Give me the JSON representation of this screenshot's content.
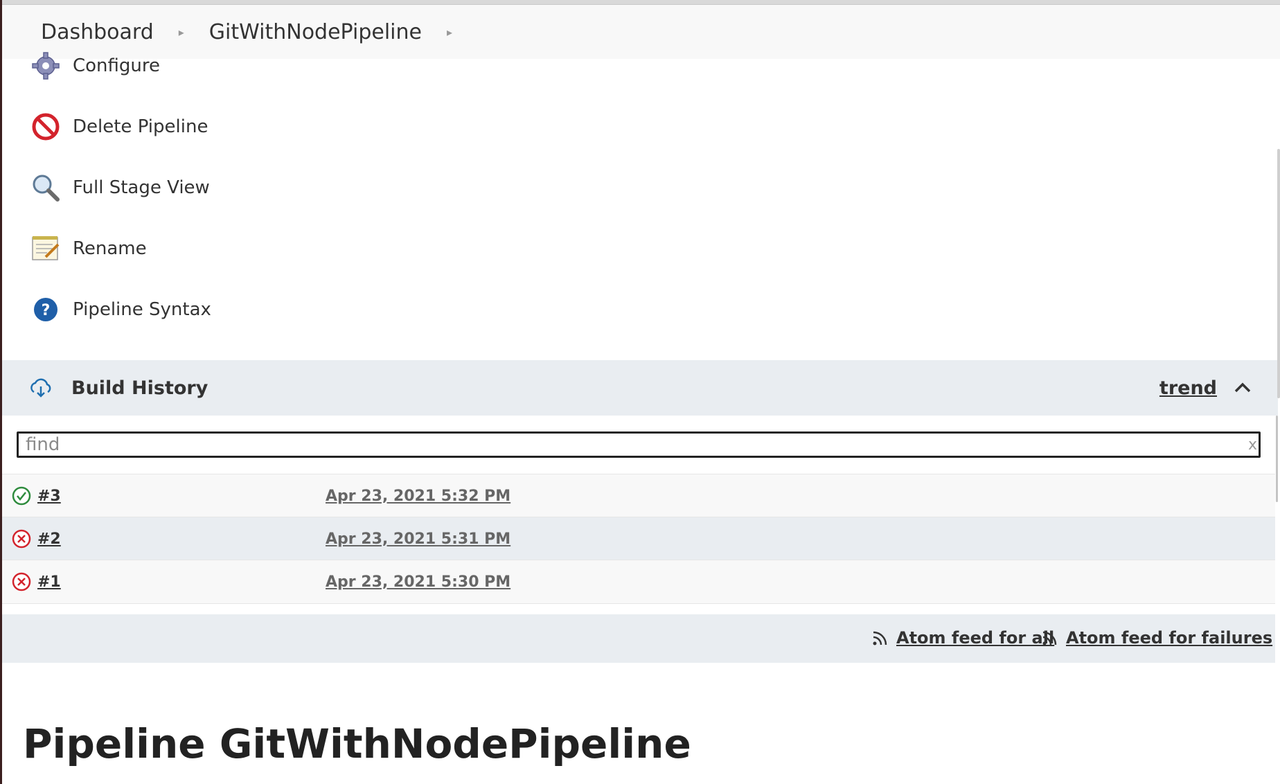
{
  "breadcrumb": {
    "items": [
      "Dashboard",
      "GitWithNodePipeline"
    ]
  },
  "tasks": [
    {
      "label": "Configure",
      "icon": "gear-icon"
    },
    {
      "label": "Delete Pipeline",
      "icon": "no-entry-icon"
    },
    {
      "label": "Full Stage View",
      "icon": "magnifier-icon"
    },
    {
      "label": "Rename",
      "icon": "notepad-pencil-icon"
    },
    {
      "label": "Pipeline Syntax",
      "icon": "help-icon"
    }
  ],
  "build_history": {
    "title": "Build History",
    "trend_label": "trend",
    "find_placeholder": "find",
    "find_clear": "x",
    "builds": [
      {
        "number": "#3",
        "date": "Apr 23, 2021 5:32 PM",
        "status": "success"
      },
      {
        "number": "#2",
        "date": "Apr 23, 2021 5:31 PM",
        "status": "failed"
      },
      {
        "number": "#1",
        "date": "Apr 23, 2021 5:30 PM",
        "status": "failed"
      }
    ],
    "feed_all": "Atom feed for all",
    "feed_failures": "Atom feed for failures"
  },
  "page_title": "Pipeline GitWithNodePipeline",
  "colors": {
    "success": "#2e8b3d",
    "failure": "#d3232c",
    "header_bg": "#e9edf1",
    "help_blue": "#1f5fa8"
  }
}
